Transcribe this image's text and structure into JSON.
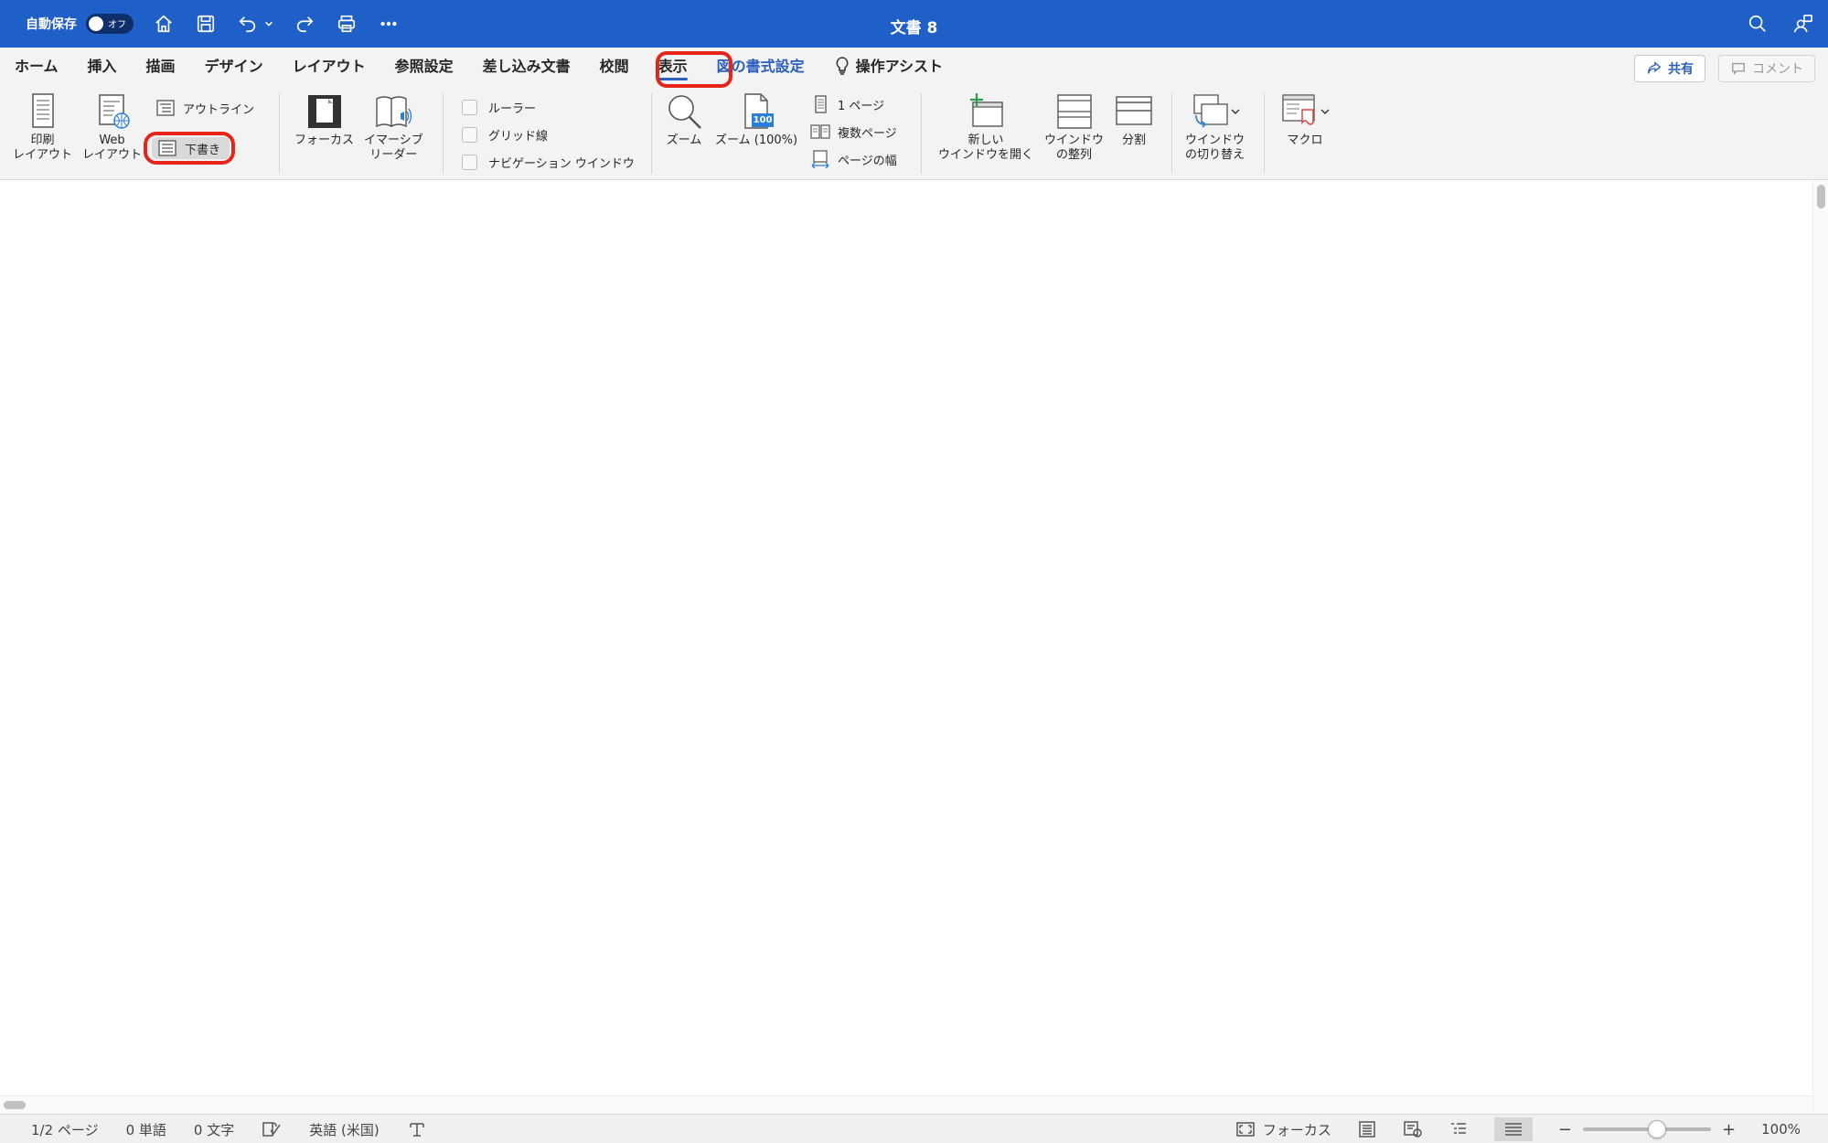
{
  "titlebar": {
    "autosave_label": "自動保存",
    "autosave_state": "オフ",
    "document_title": "文書 8",
    "icons": [
      "home-icon",
      "save-icon",
      "undo-icon",
      "redo-icon",
      "print-icon",
      "more-icon",
      "search-icon",
      "account-icon"
    ]
  },
  "ribbon": {
    "tabs": [
      {
        "label": "ホーム"
      },
      {
        "label": "挿入"
      },
      {
        "label": "描画"
      },
      {
        "label": "デザイン"
      },
      {
        "label": "レイアウト"
      },
      {
        "label": "参照設定"
      },
      {
        "label": "差し込み文書"
      },
      {
        "label": "校閲"
      },
      {
        "label": "表示",
        "active": true
      },
      {
        "label": "図の書式設定",
        "contextual": true
      },
      {
        "label": "操作アシスト"
      }
    ],
    "share_label": "共有",
    "comment_label": "コメント",
    "views": {
      "print_layout": "印刷\nレイアウト",
      "web_layout": "Web\nレイアウト",
      "outline": "アウトライン",
      "draft": "下書き"
    },
    "immersive": {
      "focus": "フォーカス",
      "immersive_reader": "イマーシブ\nリーダー"
    },
    "show": {
      "ruler": "ルーラー",
      "gridlines": "グリッド線",
      "navigation_pane": "ナビゲーション ウインドウ"
    },
    "zoom": {
      "zoom": "ズーム",
      "zoom_100": "ズーム (100%)",
      "zoom_100_badge": "100",
      "one_page": "1 ページ",
      "multiple_pages": "複数ページ",
      "page_width": "ページの幅"
    },
    "window": {
      "new_window": "新しい\nウインドウを開く",
      "arrange_all": "ウインドウ\nの整列",
      "split": "分割",
      "switch_windows": "ウインドウ\nの切り替え"
    },
    "macros": {
      "macros": "マクロ"
    },
    "highlight_color": "#e5251a",
    "accent_color": "#2b5fbf"
  },
  "statusbar": {
    "page": "1/2 ページ",
    "words": "0 単語",
    "chars": "0 文字",
    "language": "英語 (米国)",
    "focus": "フォーカス",
    "zoom_percent": "100%",
    "zoom_level": 100
  }
}
